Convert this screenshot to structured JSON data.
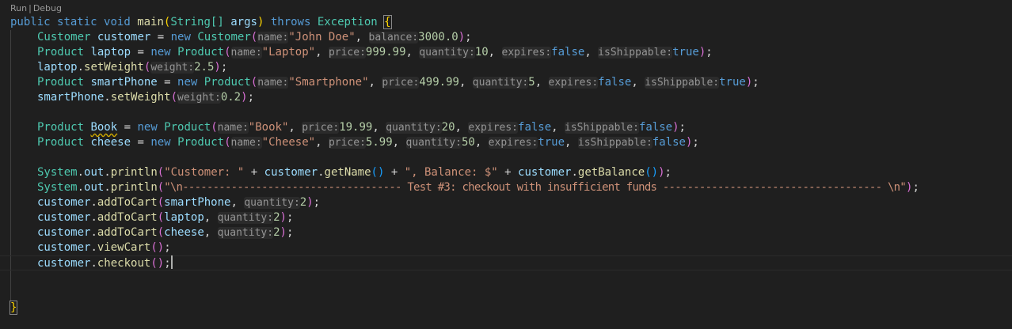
{
  "codelens": {
    "run": "Run",
    "separator": "|",
    "debug": "Debug"
  },
  "code": {
    "l1": {
      "kw1": "public",
      "kw2": "static",
      "kw3": "void",
      "fn": "main",
      "open": "(",
      "type": "String[]",
      "param": "args",
      "close": ")",
      "throws": "throws",
      "exc": "Exception",
      "brace": "{"
    },
    "l2": {
      "type": "Customer",
      "var": "customer",
      "eq": " = ",
      "new": "new",
      "cls": "Customer",
      "open": "(",
      "h1": "name:",
      "s1": "\"John Doe\"",
      "c1": ", ",
      "h2": "balance:",
      "n1": "3000.0",
      "close": ")",
      "semi": ";"
    },
    "l3": {
      "type": "Product",
      "var": "laptop",
      "eq": " = ",
      "new": "new",
      "cls": "Product",
      "open": "(",
      "h1": "name:",
      "s1": "\"Laptop\"",
      "c1": ", ",
      "h2": "price:",
      "n1": "999.99",
      "c2": ", ",
      "h3": "quantity:",
      "n2": "10",
      "c3": ", ",
      "h4": "expires:",
      "b1": "false",
      "c4": ", ",
      "h5": "isShippable:",
      "b2": "true",
      "close": ")",
      "semi": ";"
    },
    "l4": {
      "var": "laptop",
      "dot": ".",
      "fn": "setWeight",
      "open": "(",
      "h1": "weight:",
      "n1": "2.5",
      "close": ")",
      "semi": ";"
    },
    "l5": {
      "type": "Product",
      "var": "smartPhone",
      "eq": " = ",
      "new": "new",
      "cls": "Product",
      "open": "(",
      "h1": "name:",
      "s1": "\"Smartphone\"",
      "c1": ", ",
      "h2": "price:",
      "n1": "499.99",
      "c2": ", ",
      "h3": "quantity:",
      "n2": "5",
      "c3": ", ",
      "h4": "expires:",
      "b1": "false",
      "c4": ", ",
      "h5": "isShippable:",
      "b2": "true",
      "close": ")",
      "semi": ";"
    },
    "l6": {
      "var": "smartPhone",
      "dot": ".",
      "fn": "setWeight",
      "open": "(",
      "h1": "weight:",
      "n1": "0.2",
      "close": ")",
      "semi": ";"
    },
    "l8": {
      "type": "Product",
      "var": "Book",
      "eq": " = ",
      "new": "new",
      "cls": "Product",
      "open": "(",
      "h1": "name:",
      "s1": "\"Book\"",
      "c1": ", ",
      "h2": "price:",
      "n1": "19.99",
      "c2": ", ",
      "h3": "quantity:",
      "n2": "20",
      "c3": ", ",
      "h4": "expires:",
      "b1": "false",
      "c4": ", ",
      "h5": "isShippable:",
      "b2": "false",
      "close": ")",
      "semi": ";"
    },
    "l9": {
      "type": "Product",
      "var": "cheese",
      "eq": " = ",
      "new": "new",
      "cls": "Product",
      "open": "(",
      "h1": "name:",
      "s1": "\"Cheese\"",
      "c1": ", ",
      "h2": "price:",
      "n1": "5.99",
      "c2": ", ",
      "h3": "quantity:",
      "n2": "50",
      "c3": ", ",
      "h4": "expires:",
      "b1": "true",
      "c4": ", ",
      "h5": "isShippable:",
      "b2": "false",
      "close": ")",
      "semi": ";"
    },
    "l11": {
      "sys": "System",
      "d1": ".",
      "out": "out",
      "d2": ".",
      "fn": "println",
      "open": "(",
      "s1": "\"Customer: \"",
      "p1": " + ",
      "v1": "customer",
      "d3": ".",
      "fn2": "getName",
      "o2": "(",
      "c2": ")",
      "p2": " + ",
      "s2": "\", Balance: $\"",
      "p3": " + ",
      "v2": "customer",
      "d4": ".",
      "fn3": "getBalance",
      "o3": "(",
      "c3": ")",
      "close": ")",
      "semi": ";"
    },
    "l12": {
      "sys": "System",
      "d1": ".",
      "out": "out",
      "d2": ".",
      "fn": "println",
      "open": "(",
      "s1": "\"\\n------------------------------------ Test #3: checkout with insufficient funds ------------------------------------ \\n\"",
      "close": ")",
      "semi": ";"
    },
    "l13": {
      "var": "customer",
      "dot": ".",
      "fn": "addToCart",
      "open": "(",
      "a1": "smartPhone",
      "c1": ", ",
      "h1": "quantity:",
      "n1": "2",
      "close": ")",
      "semi": ";"
    },
    "l14": {
      "var": "customer",
      "dot": ".",
      "fn": "addToCart",
      "open": "(",
      "a1": "laptop",
      "c1": ", ",
      "h1": "quantity:",
      "n1": "2",
      "close": ")",
      "semi": ";"
    },
    "l15": {
      "var": "customer",
      "dot": ".",
      "fn": "addToCart",
      "open": "(",
      "a1": "cheese",
      "c1": ", ",
      "h1": "quantity:",
      "n1": "2",
      "close": ")",
      "semi": ";"
    },
    "l16": {
      "var": "customer",
      "dot": ".",
      "fn": "viewCart",
      "open": "(",
      "close": ")",
      "semi": ";"
    },
    "l17": {
      "var": "customer",
      "dot": ".",
      "fn": "checkout",
      "open": "(",
      "close": ")",
      "semi": ";"
    },
    "l20": {
      "brace": "}"
    }
  }
}
